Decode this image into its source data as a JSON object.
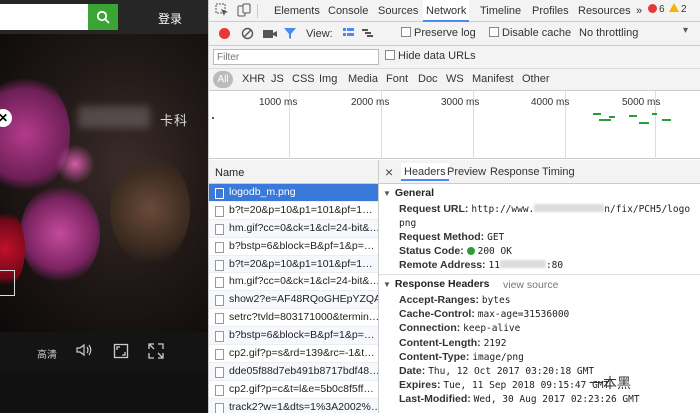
{
  "site": {
    "login_label": "登录",
    "video_title": "卡科",
    "quality_label": "高清"
  },
  "devtools": {
    "tabs": [
      "Elements",
      "Console",
      "Sources",
      "Network",
      "Timeline",
      "Profiles",
      "Resources"
    ],
    "more_tabs": "»",
    "error_count": "6",
    "warning_count": "2",
    "toolbar": {
      "view_label": "View:",
      "preserve_log": "Preserve log",
      "disable_cache": "Disable cache",
      "throttle": "No throttling"
    },
    "filter": {
      "placeholder": "Filter",
      "hide_data_urls": "Hide data URLs"
    },
    "types": [
      "All",
      "XHR",
      "JS",
      "CSS",
      "Img",
      "Media",
      "Font",
      "Doc",
      "WS",
      "Manifest",
      "Other"
    ],
    "overview_ticks": [
      "1000 ms",
      "2000 ms",
      "3000 ms",
      "4000 ms",
      "5000 ms"
    ],
    "list": {
      "header": "Name",
      "rows": [
        "logodb_m.png",
        "b?t=20&p=10&p1=101&pf=1…",
        "hm.gif?cc=0&ck=1&cl=24-bit&…",
        "b?bstp=6&block=B&pf=1&p=…",
        "b?t=20&p=10&p1=101&pf=1…",
        "hm.gif?cc=0&ck=1&cl=24-bit&…",
        "show2?e=AF48RQoGHEpYZQA…",
        "setrc?tvld=803171000&termin…",
        "b?bstp=6&block=B&pf=1&p=…",
        "cp2.gif?p=s&rd=139&rc=-1&t…",
        "dde05f88d7eb491b8717bdf48…",
        "cp2.gif?p=c&t=l&e=5b0c8f5ff…",
        "track2?w=1&dts=1%3A2002%…"
      ]
    },
    "detail": {
      "close": "×",
      "tabs": [
        "Headers",
        "Preview",
        "Response",
        "Timing"
      ],
      "general_title": "General",
      "request_url_key": "Request URL:",
      "request_url_val": "http://www.",
      "request_url_tail": "n/fix/PCH5/logo",
      "request_url_line2": "png",
      "request_method_key": "Request Method:",
      "request_method_val": "GET",
      "status_code_key": "Status Code:",
      "status_code_val": "200 OK",
      "remote_address_key": "Remote Address:",
      "remote_address_val": "11",
      "remote_address_tail": ":80",
      "response_headers_title": "Response Headers",
      "view_source": "view source",
      "headers": [
        {
          "k": "Accept-Ranges:",
          "v": "bytes"
        },
        {
          "k": "Cache-Control:",
          "v": "max-age=31536000"
        },
        {
          "k": "Connection:",
          "v": "keep-alive"
        },
        {
          "k": "Content-Length:",
          "v": "2192"
        },
        {
          "k": "Content-Type:",
          "v": "image/png"
        },
        {
          "k": "Date:",
          "v": "Thu, 12 Oct 2017 03:20:18 GMT"
        },
        {
          "k": "Expires:",
          "v": "Tue, 11 Sep 2018 09:15:47 GMT"
        },
        {
          "k": "Last-Modified:",
          "v": "Wed, 30 Aug 2017 02:23:26 GMT"
        }
      ]
    },
    "watermark": "一本黑"
  },
  "colors": {
    "accent": "#4a8af4",
    "record": "#e53935",
    "selected_row": "#3879d9",
    "search_button": "#3aa535",
    "status_ok": "#2e9b3a"
  }
}
